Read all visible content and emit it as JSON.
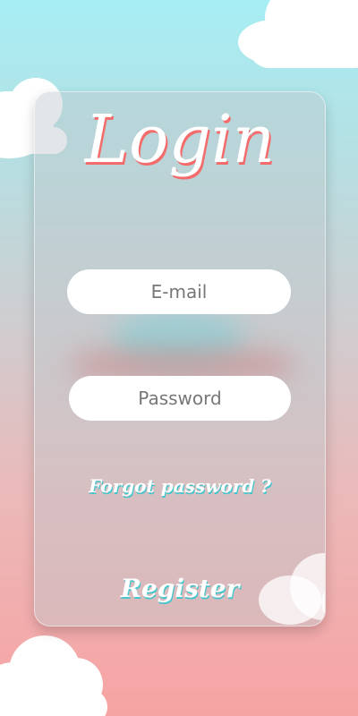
{
  "login": {
    "title": "Login",
    "email_placeholder": "E-mail",
    "password_placeholder": "Password",
    "forgot_password_label": "Forgot password ?",
    "register_label": "Register"
  },
  "colors": {
    "background_top": "#a6eef4",
    "background_bottom": "#f7a3a3",
    "title_shadow": "#f46b6b",
    "link_shadow": "#45c5cc"
  }
}
